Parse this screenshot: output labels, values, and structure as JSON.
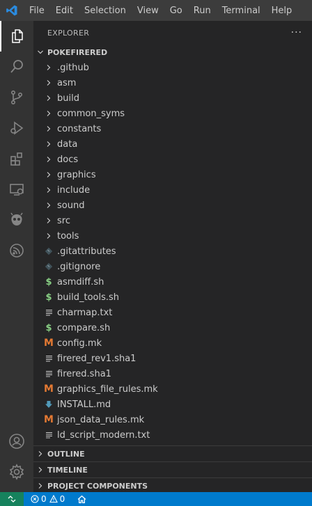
{
  "menu": [
    "File",
    "Edit",
    "Selection",
    "View",
    "Go",
    "Run",
    "Terminal",
    "Help"
  ],
  "explorer": {
    "title": "EXPLORER",
    "more": "···",
    "project": "POKEFIRERED",
    "items": [
      {
        "label": ".github",
        "kind": "folder"
      },
      {
        "label": "asm",
        "kind": "folder"
      },
      {
        "label": "build",
        "kind": "folder"
      },
      {
        "label": "common_syms",
        "kind": "folder"
      },
      {
        "label": "constants",
        "kind": "folder"
      },
      {
        "label": "data",
        "kind": "folder"
      },
      {
        "label": "docs",
        "kind": "folder"
      },
      {
        "label": "graphics",
        "kind": "folder"
      },
      {
        "label": "include",
        "kind": "folder"
      },
      {
        "label": "sound",
        "kind": "folder"
      },
      {
        "label": "src",
        "kind": "folder"
      },
      {
        "label": "tools",
        "kind": "folder"
      },
      {
        "label": ".gitattributes",
        "kind": "git"
      },
      {
        "label": ".gitignore",
        "kind": "git"
      },
      {
        "label": "asmdiff.sh",
        "kind": "shell"
      },
      {
        "label": "build_tools.sh",
        "kind": "shell"
      },
      {
        "label": "charmap.txt",
        "kind": "text"
      },
      {
        "label": "compare.sh",
        "kind": "shell"
      },
      {
        "label": "config.mk",
        "kind": "makefile"
      },
      {
        "label": "firered_rev1.sha1",
        "kind": "text"
      },
      {
        "label": "firered.sha1",
        "kind": "text"
      },
      {
        "label": "graphics_file_rules.mk",
        "kind": "makefile"
      },
      {
        "label": "INSTALL.md",
        "kind": "markdown"
      },
      {
        "label": "json_data_rules.mk",
        "kind": "makefile"
      },
      {
        "label": "ld_script_modern.txt",
        "kind": "text"
      }
    ]
  },
  "sections": [
    "OUTLINE",
    "TIMELINE",
    "PROJECT COMPONENTS"
  ],
  "statusbar": {
    "errors": "0",
    "warnings": "0"
  },
  "icons": {
    "activity": [
      "explorer-icon",
      "search-icon",
      "source-control-icon",
      "run-debug-icon",
      "extensions-icon",
      "remote-explorer-icon",
      "platformio-icon",
      "espressif-icon",
      "accounts-icon",
      "settings-gear-icon"
    ],
    "file_kinds": {
      "folder": "chevron-right-icon",
      "git": "git-diamond-icon",
      "shell": "dollar-icon",
      "text": "lines-icon",
      "makefile": "m-icon",
      "markdown": "download-arrow-icon"
    }
  },
  "colors": {
    "titlebar": "#3c3c3c",
    "activitybar": "#333333",
    "sidebar": "#252526",
    "statusbar": "#007acc",
    "remote": "#16825d",
    "shell_icon": "#89d185",
    "makefile_icon": "#e37933",
    "markdown_icon": "#519aba",
    "git_icon": "#41535b"
  }
}
